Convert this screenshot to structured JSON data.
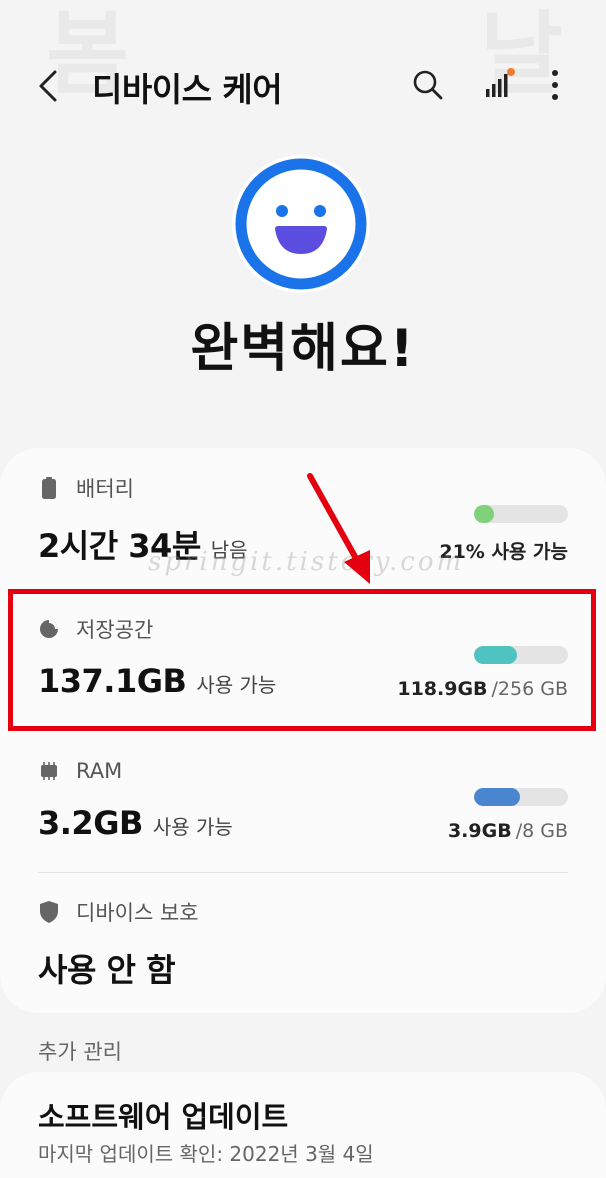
{
  "header": {
    "title": "디바이스 케어"
  },
  "status": {
    "message": "완벽해요!"
  },
  "watermark": "springit.tistory.com",
  "battery": {
    "label": "배터리",
    "main_value": "2시간 34분",
    "suffix": "남음",
    "note": "21% 사용 가능",
    "level": 0.21,
    "color": "#7fd27a"
  },
  "storage": {
    "label": "저장공간",
    "main_value": "137.1GB",
    "suffix": "사용 가능",
    "used": "118.9GB",
    "total": "/256 GB",
    "level": 0.46,
    "color": "#4fc3c2"
  },
  "ram": {
    "label": "RAM",
    "main_value": "3.2GB",
    "suffix": "사용 가능",
    "used": "3.9GB",
    "total": "/8 GB",
    "level": 0.49,
    "color": "#4a86d0"
  },
  "protection": {
    "label": "디바이스 보호",
    "main_value": "사용 안 함"
  },
  "extra": {
    "section_label": "추가 관리",
    "software_update_title": "소프트웨어 업데이트",
    "software_update_sub": "마지막 업데이트 확인: 2022년 3월 4일"
  },
  "colors": {
    "accent_blue": "#1a73e8",
    "smiley_purple": "#5b4de0",
    "highlight_red": "#e3000f",
    "notify_dot": "#ef7d2f"
  },
  "icons": {
    "back": "chevron-left-icon",
    "search": "search-icon",
    "signal": "signal-bars-icon",
    "more": "more-vertical-icon",
    "battery": "battery-icon",
    "storage": "pie-chart-icon",
    "ram": "chip-icon",
    "protection": "shield-icon"
  }
}
